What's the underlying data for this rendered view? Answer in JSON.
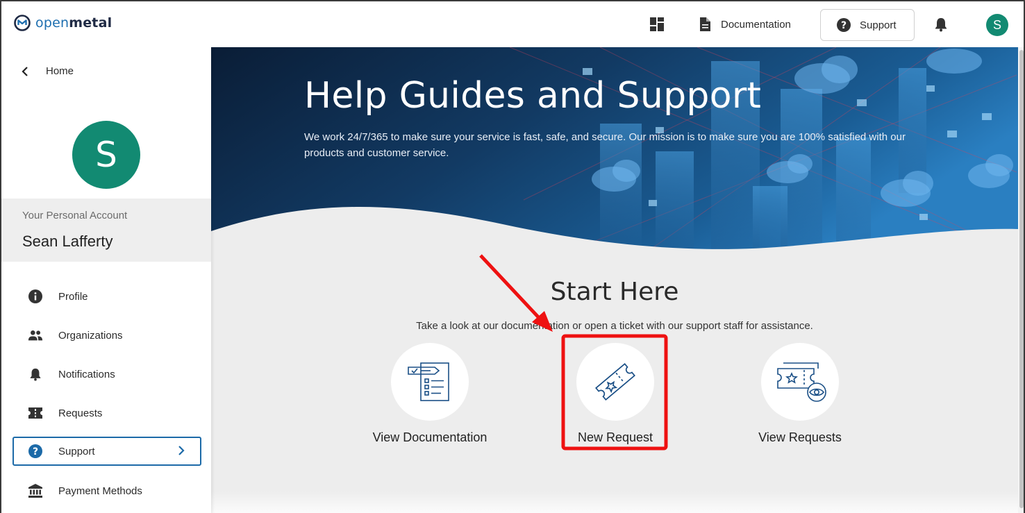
{
  "app": {
    "logo_part1": "open",
    "logo_part2": "metal"
  },
  "topbar": {
    "dashboard_icon": "dashboard-grid-icon",
    "documentation_label": "Documentation",
    "support_label": "Support",
    "bell_icon": "bell-icon",
    "avatar_initial": "S"
  },
  "sidebar": {
    "home_label": "Home",
    "avatar_initial": "S",
    "account_label": "Your Personal Account",
    "account_name": "Sean Lafferty",
    "items": [
      {
        "label": "Profile",
        "icon": "info-icon"
      },
      {
        "label": "Organizations",
        "icon": "people-icon"
      },
      {
        "label": "Notifications",
        "icon": "bell-icon"
      },
      {
        "label": "Requests",
        "icon": "ticket-icon"
      },
      {
        "label": "Support",
        "icon": "help-circle-icon",
        "active": true
      },
      {
        "label": "Payment Methods",
        "icon": "bank-icon"
      }
    ]
  },
  "hero": {
    "title": "Help Guides and Support",
    "text": "We work 24/7/365 to make sure your service is fast, safe, and secure. Our mission is to make sure you are 100% satisfied with our products and customer service."
  },
  "start": {
    "title": "Start Here",
    "subtitle": "Take a look at our documentation or open a ticket with our support staff for assistance.",
    "cards": [
      {
        "label": "View Documentation",
        "icon": "checklist-document-icon"
      },
      {
        "label": "New Request",
        "icon": "ticket-star-icon"
      },
      {
        "label": "View Requests",
        "icon": "tickets-eye-icon"
      }
    ]
  },
  "colors": {
    "brand_blue": "#1e6fb0",
    "avatar_green": "#128a72",
    "active_border": "#1c6aa8",
    "annotation_red": "#ee1111",
    "hero_dark": "#0b2340"
  }
}
